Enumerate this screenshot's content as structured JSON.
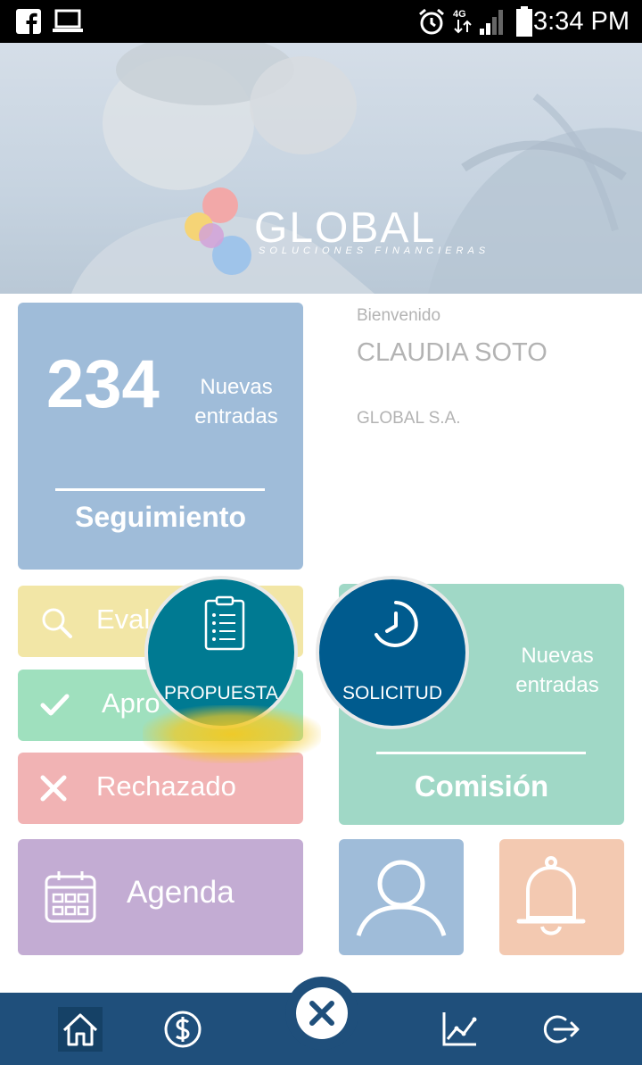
{
  "status_bar": {
    "time": "3:34 PM",
    "network": "4G"
  },
  "hero": {
    "brand": "GLOBAL",
    "brand_sub": "SOLUCIONES FINANCIERAS"
  },
  "tracking": {
    "count": "234",
    "entries_label": "Nuevas entradas",
    "title": "Seguimiento"
  },
  "welcome": {
    "greeting": "Bienvenido",
    "user_name": "CLAUDIA SOTO",
    "company": "GLOBAL S.A."
  },
  "status_rows": [
    {
      "label": "Evaluación",
      "visible_text": "Eval",
      "icon": "search-icon"
    },
    {
      "label": "Aprobado",
      "visible_text": "Apro",
      "icon": "check-icon"
    },
    {
      "label": "Rechazado",
      "visible_text": "Rechazado",
      "icon": "close-icon"
    }
  ],
  "agenda": {
    "label": "Agenda",
    "icon": "calendar-icon"
  },
  "commission": {
    "entries_label": "Nuevas entradas",
    "title": "Comisión"
  },
  "fab_menu": {
    "propuesta": "PROPUESTA",
    "solicitud": "SOLICITUD"
  },
  "bottom_nav": [
    {
      "name": "home",
      "icon": "home-icon",
      "active": true
    },
    {
      "name": "payments",
      "icon": "dollar-icon"
    },
    {
      "name": "close-menu",
      "icon": "close-icon"
    },
    {
      "name": "stats",
      "icon": "chart-icon"
    },
    {
      "name": "logout",
      "icon": "logout-icon"
    }
  ],
  "colors": {
    "navy": "#1f4f7b",
    "blue_tile": "#9fbcd9",
    "yellow_tile": "#f2e6a6",
    "green_tile": "#9fe0be",
    "red_tile": "#f1b3b4",
    "purple_tile": "#c3acd3",
    "teal_tile": "#a0d8c6",
    "peach_tile": "#f3c9b1",
    "propuesta": "#007a92",
    "solicitud": "#005b8e"
  }
}
